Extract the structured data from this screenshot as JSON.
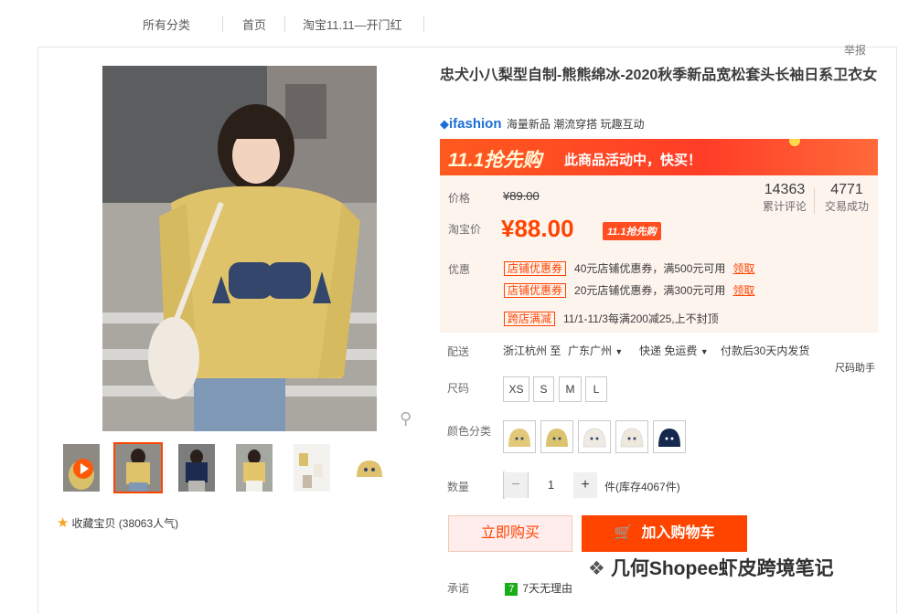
{
  "top_nav": {
    "items": [
      "所有分类",
      "首页",
      "淘宝11.11—开门红"
    ]
  },
  "report_label": "举报",
  "product": {
    "title": "忠犬小八梨型自制-熊熊绵冰-2020秋季新品宽松套头长袖日系卫衣女",
    "brand_logo": "ifashion",
    "brand_tags": "海量新品 潮流穿搭 玩趣互动"
  },
  "banner": {
    "logo_text": "11.1抢先购",
    "text": "此商品活动中，快买！"
  },
  "price": {
    "label": "价格",
    "original": "¥89.00",
    "taobao_label": "淘宝价",
    "current": "¥88.00",
    "badge": "11.1抢先购"
  },
  "stats": [
    {
      "value": "14363",
      "label": "累计评论"
    },
    {
      "value": "4771",
      "label": "交易成功"
    }
  ],
  "promo": {
    "label": "优惠",
    "coupons": [
      {
        "tag": "店铺优惠券",
        "text": "40元店铺优惠券，满500元可用",
        "action": "领取"
      },
      {
        "tag": "店铺优惠券",
        "text": "20元店铺优惠券，满300元可用",
        "action": "领取"
      }
    ],
    "cross": {
      "tag": "跨店满减",
      "text": "11/1-11/3每满200减25,上不封顶"
    }
  },
  "delivery": {
    "label": "配送",
    "from": "浙江杭州 至",
    "to": "广东广州",
    "ship": "快递 免运费",
    "time": "付款后30天内发货"
  },
  "size": {
    "label": "尺码",
    "helper": "尺码助手",
    "options": [
      "XS",
      "S",
      "M",
      "L"
    ]
  },
  "color": {
    "label": "颜色分类",
    "swatches": [
      "#e2c97a",
      "#dcc36f",
      "#f0ebe2",
      "#efe8dc",
      "#15284d"
    ]
  },
  "qty": {
    "label": "数量",
    "minus": "−",
    "value": "1",
    "plus": "+",
    "stock": "件(库存4067件)"
  },
  "buttons": {
    "buy": "立即购买",
    "cart": "加入购物车"
  },
  "favorite": {
    "text": "收藏宝贝 (38063人气)"
  },
  "watermark": "几何Shopee虾皮跨境笔记",
  "promise": {
    "label": "承诺",
    "icon_text": "7",
    "text": "7天无理由"
  },
  "colors": {
    "accent": "#ff4400",
    "banner": "#ff4a25",
    "price_bg": "#fef4ee",
    "brand": "#1a6fd6"
  }
}
